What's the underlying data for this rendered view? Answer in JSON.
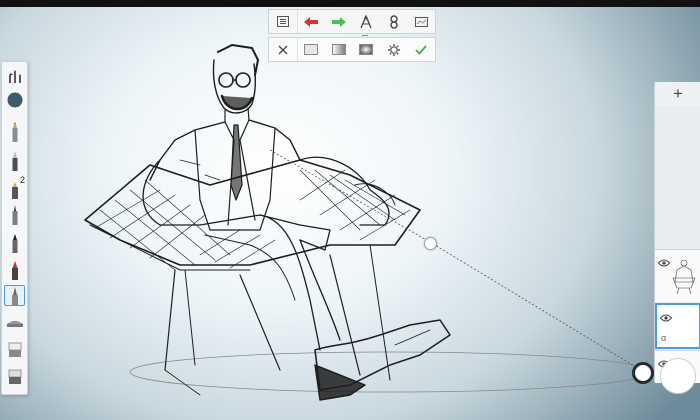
{
  "colors": {
    "current_color": "#3d5a6a",
    "undo_arrow": "#d9332a",
    "redo_arrow": "#4fbf55",
    "confirm_check": "#3db03f",
    "accent": "#4d9bd6"
  },
  "left_toolbar": {
    "tools": [
      {
        "name": "brush-library-icon"
      },
      {
        "name": "color-swatch"
      },
      {
        "name": "pencil-icon"
      },
      {
        "name": "ballpoint-pen-icon"
      },
      {
        "name": "marker-icon",
        "badge": "2"
      },
      {
        "name": "fineliner-icon"
      },
      {
        "name": "fill-pen-icon"
      },
      {
        "name": "ink-pen-icon"
      },
      {
        "name": "airbrush-icon",
        "selected": true
      },
      {
        "name": "smudge-icon"
      },
      {
        "name": "eraser-icon"
      },
      {
        "name": "blender-icon"
      }
    ]
  },
  "top_toolbar": {
    "row1": [
      "menu-icon",
      "undo-icon",
      "redo-icon",
      "ruler-icon",
      "guides-icon",
      "layer-icon"
    ],
    "row2": [
      "close-icon",
      "linear-fill-icon",
      "gradient-fill-icon",
      "radial-fill-icon",
      "settings-icon",
      "confirm-icon"
    ]
  },
  "layer_panel": {
    "add_label": "+",
    "layers": [
      {
        "name": "layer-sketch",
        "label": ""
      },
      {
        "name": "layer-empty-selected",
        "label": "α"
      },
      {
        "name": "layer-background",
        "label": ""
      }
    ]
  }
}
